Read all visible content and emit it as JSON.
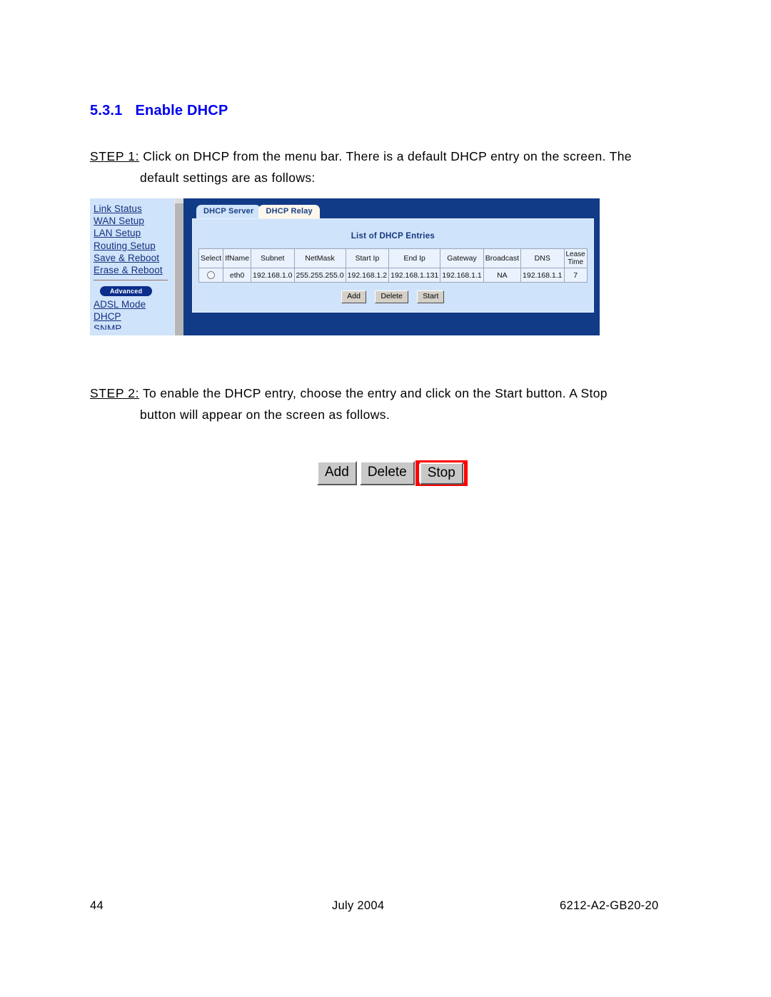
{
  "heading": {
    "number": "5.3.1",
    "title": "Enable DHCP"
  },
  "steps": [
    {
      "label": "STEP 1:",
      "line1": " Click on DHCP from the menu bar.  There is a default DHCP entry on the screen.  The",
      "line2": "default settings are as follows:"
    },
    {
      "label": "STEP 2:",
      "line1": " To enable the DHCP entry, choose the entry and click on the Start button.  A Stop",
      "line2": "button will appear on the screen as follows."
    }
  ],
  "screenshot": {
    "sidebar": {
      "links": [
        "Link Status",
        "WAN Setup",
        "LAN Setup",
        "Routing Setup",
        "Save & Reboot",
        "Erase & Reboot"
      ],
      "advanced_label": "Advanced",
      "advanced_links": [
        "ADSL Mode",
        "DHCP"
      ],
      "clipped_link": "SNMP"
    },
    "tabs": [
      {
        "label": "DHCP Server",
        "active": true
      },
      {
        "label": "DHCP Relay",
        "active": false
      }
    ],
    "panel_title": "List of DHCP Entries",
    "table": {
      "headers": [
        "Select",
        "IfName",
        "Subnet",
        "NetMask",
        "Start Ip",
        "End Ip",
        "Gateway",
        "Broadcast",
        "DNS",
        "Lease Time"
      ],
      "lease_header_line1": "Lease",
      "lease_header_line2": "Time",
      "rows": [
        {
          "select": "",
          "ifname": "eth0",
          "subnet": "192.168.1.0",
          "netmask": "255.255.255.0",
          "start_ip": "192.168.1.2",
          "end_ip": "192.168.1.131",
          "gateway": "192.168.1.1",
          "broadcast": "NA",
          "dns": "192.168.1.1",
          "lease_time": "7"
        }
      ]
    },
    "buttons": [
      "Add",
      "Delete",
      "Start"
    ]
  },
  "figure_buttons": {
    "add": "Add",
    "delete": "Delete",
    "stop": "Stop",
    "highlight_color": "#ff0000"
  },
  "footer": {
    "page": "44",
    "date": "July 2004",
    "document": "6212-A2-GB20-20"
  }
}
